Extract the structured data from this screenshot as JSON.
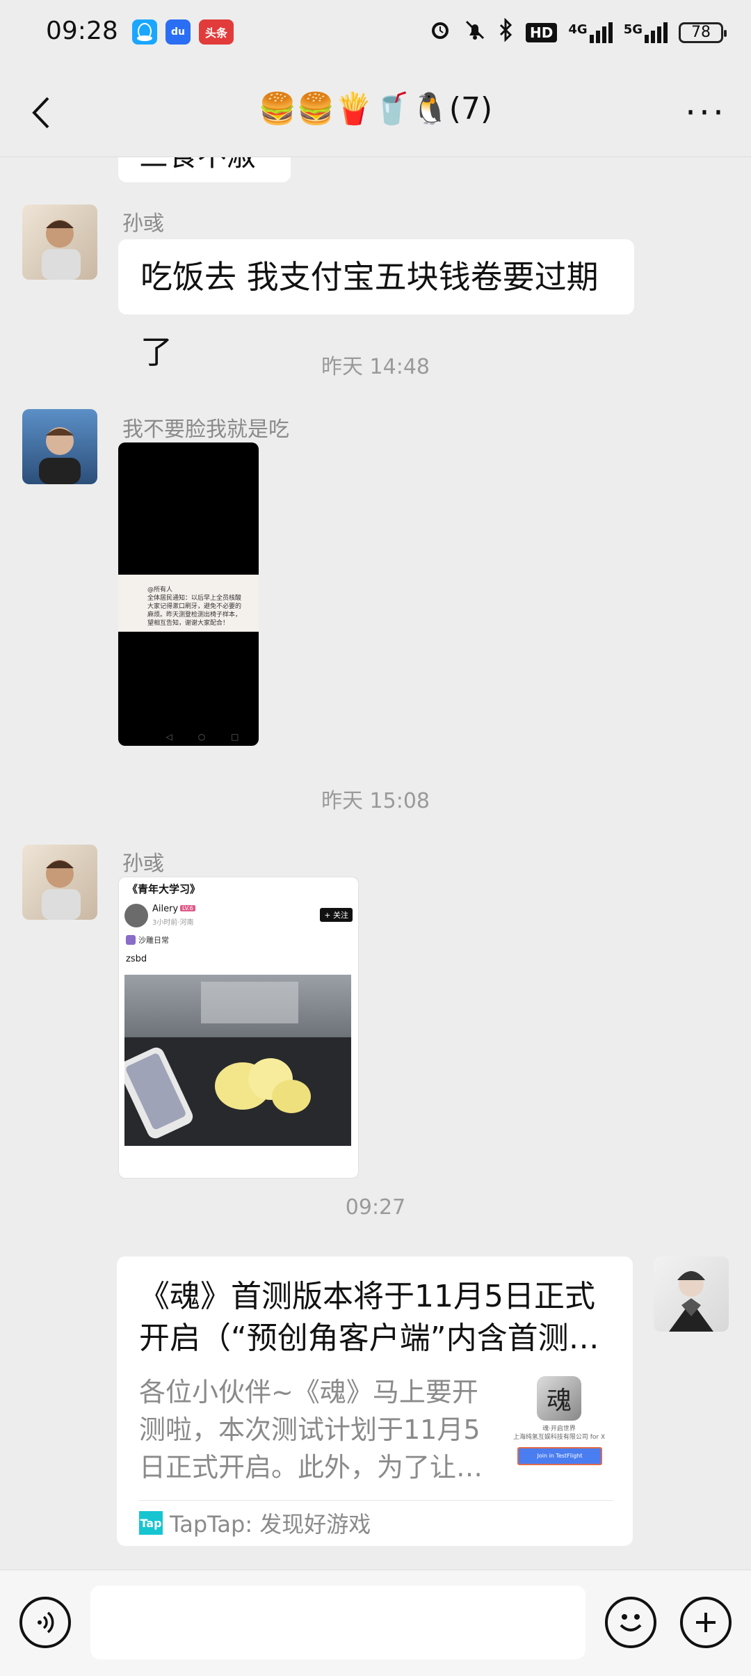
{
  "status_bar": {
    "time": "09:28",
    "apps": [
      "QQ",
      "百度",
      "头条"
    ],
    "icons": [
      "alarm-icon",
      "mute-icon",
      "bluetooth-icon",
      "hd-icon",
      "signal-4g-icon",
      "signal-5g-icon"
    ],
    "hd_label": "HD",
    "net1": "4G",
    "net2": "5G",
    "battery": "78"
  },
  "nav": {
    "title": "🍔🍔🍟🥤🐧(7)",
    "more": "···"
  },
  "messages": {
    "partial_top": "三食不淑",
    "m1_nick": "孙彧",
    "m1_text": "吃饭去 我支付宝五块钱卷要过期了",
    "ts1": "昨天 14:48",
    "m2_nick": "我不要脸我就是吃",
    "m2_image_text": "@所有人\n全体居民通知：以后早上全员核酸\n大家记得漱口刷牙，避免不必要的\n麻烦。昨天测登检测出椅子样本，\n望相互告知，谢谢大家配合！",
    "ts2": "昨天 15:08",
    "m3_nick": "孙彧",
    "m3_card_title": "《青年大学习》",
    "m3_card_user": "Ailery",
    "m3_card_badge": "LV.6",
    "m3_card_meta": "3小时前·河南",
    "m3_card_follow": "+ 关注",
    "m3_card_tag": "沙雕日常",
    "m3_card_body": "zsbd",
    "ts3": "09:27",
    "link_title": "《魂》首测版本将于11月5日正式开启（“预创角客户端”内含首测…",
    "link_desc": "各位小伙伴~《魂》马上要开测啦，本次测试计划于11月5日正式开启。此外，为了让…",
    "link_thumb_caption": "魂·开启世界\n上海纯氢互娱科技有限公司 for X",
    "link_thumb_btn": "Join in TestFlight",
    "link_source": "TapTap: 发现好游戏",
    "link_source_icon": "Tap"
  },
  "input": {
    "voice_icon": "voice-icon",
    "emoji_icon": "emoji-icon",
    "plus_icon": "plus-icon"
  }
}
